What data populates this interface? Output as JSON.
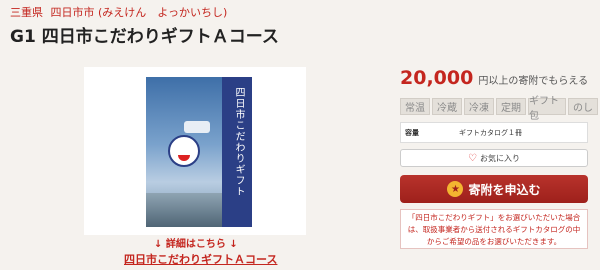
{
  "breadcrumb": {
    "prefecture": "三重県",
    "city": "四日市市 (みえけん　よっかいちし)"
  },
  "product": {
    "title": "G1 四日市こだわりギフトＡコース",
    "image_title": "四日市こだわりギフト"
  },
  "links": {
    "details": "↓ 詳細はこちら ↓",
    "course": "四日市こだわりギフトＡコース"
  },
  "price": {
    "amount": "20,000",
    "unit_text": "円以上の寄附でもらえる"
  },
  "temperature_tags": [
    "常温",
    "冷蔵",
    "冷凍",
    "定期",
    "ギフト包",
    "のし"
  ],
  "capacity": {
    "label": "容量",
    "value": "ギフトカタログ１冊"
  },
  "favorite_label": "お気に入り",
  "donate_label": "寄附を申込む",
  "notice_text": "「四日市こだわりギフト」をお選びいただいた場合は、取扱事業者から送付されるギフトカタログの中からご希望の品をお選びいただきます。",
  "colors": {
    "accent": "#c4261f",
    "button": "#a9251f",
    "star": "#f3b530",
    "booklet_band": "#2b3f86"
  }
}
